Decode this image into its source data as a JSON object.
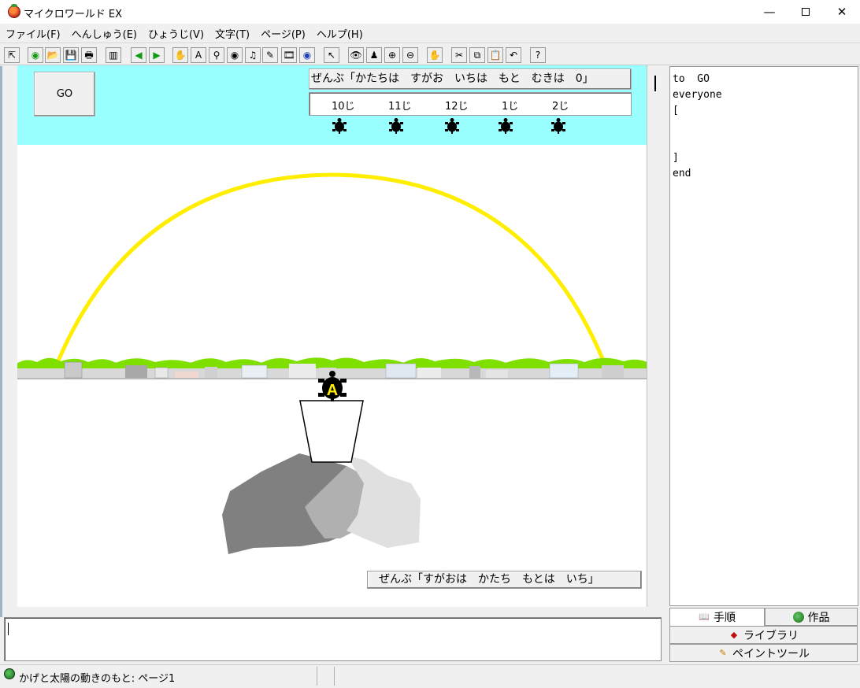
{
  "window": {
    "title": "マイクロワールド EX",
    "controls": {
      "minimize": "—",
      "close": "✕"
    }
  },
  "menu": [
    "ファイル(F)",
    "へんしゅう(E)",
    "ひょうじ(V)",
    "文字(T)",
    "ページ(P)",
    "ヘルプ(H)"
  ],
  "toolbar": {
    "icons": [
      "pointer-arrow-icon",
      "globe-icon",
      "open-folder-icon",
      "save-disk-icon",
      "print-icon",
      "split-view-icon",
      "prev-page-icon",
      "next-page-icon",
      "hatch-turtle-icon",
      "textbox-icon",
      "slider-icon",
      "button-eye-icon",
      "music-note-icon",
      "pen-icon",
      "film-icon",
      "globe-blue-icon",
      "select-arrow-icon",
      "eye-icon",
      "stamp-icon",
      "zoom-in-icon",
      "zoom-out-icon",
      "stop-hand-icon",
      "scissors-icon",
      "copy-icon",
      "paste-icon",
      "undo-icon",
      "help-icon"
    ],
    "glyphs": [
      "⇱",
      "◉",
      "📂",
      "💾",
      "🖶",
      "▥",
      "◀",
      "▶",
      "✋",
      "A",
      "⚲",
      "◉",
      "♫",
      "✎",
      "🎞",
      "◉",
      "↖",
      "👁",
      "♟",
      "⊕",
      "⊖",
      "✋",
      "✂",
      "⧉",
      "📋",
      "↶",
      "?"
    ]
  },
  "stage": {
    "header_color": "#99ffff",
    "go_button": "GO",
    "top_command": "ぜんぶ「かたちは　すがお　いちは　もと　むきは　0」",
    "time_labels": [
      "10じ",
      "11じ",
      "12じ",
      "1じ",
      "2じ"
    ],
    "turtle_label": "A",
    "bottom_command": "ぜんぶ「すがおは　かたち　もとは　いち」",
    "sun_arc_color": "#ffee00"
  },
  "code": {
    "lines": [
      "to  GO",
      "everyone",
      "[",
      "",
      "",
      "]",
      "end"
    ]
  },
  "tabs": {
    "procedure": "手順",
    "works": "作品",
    "library": "ライブラリ",
    "paint": "ペイントツール"
  },
  "status": {
    "text": "かげと太陽の動きのもと: ページ1"
  }
}
